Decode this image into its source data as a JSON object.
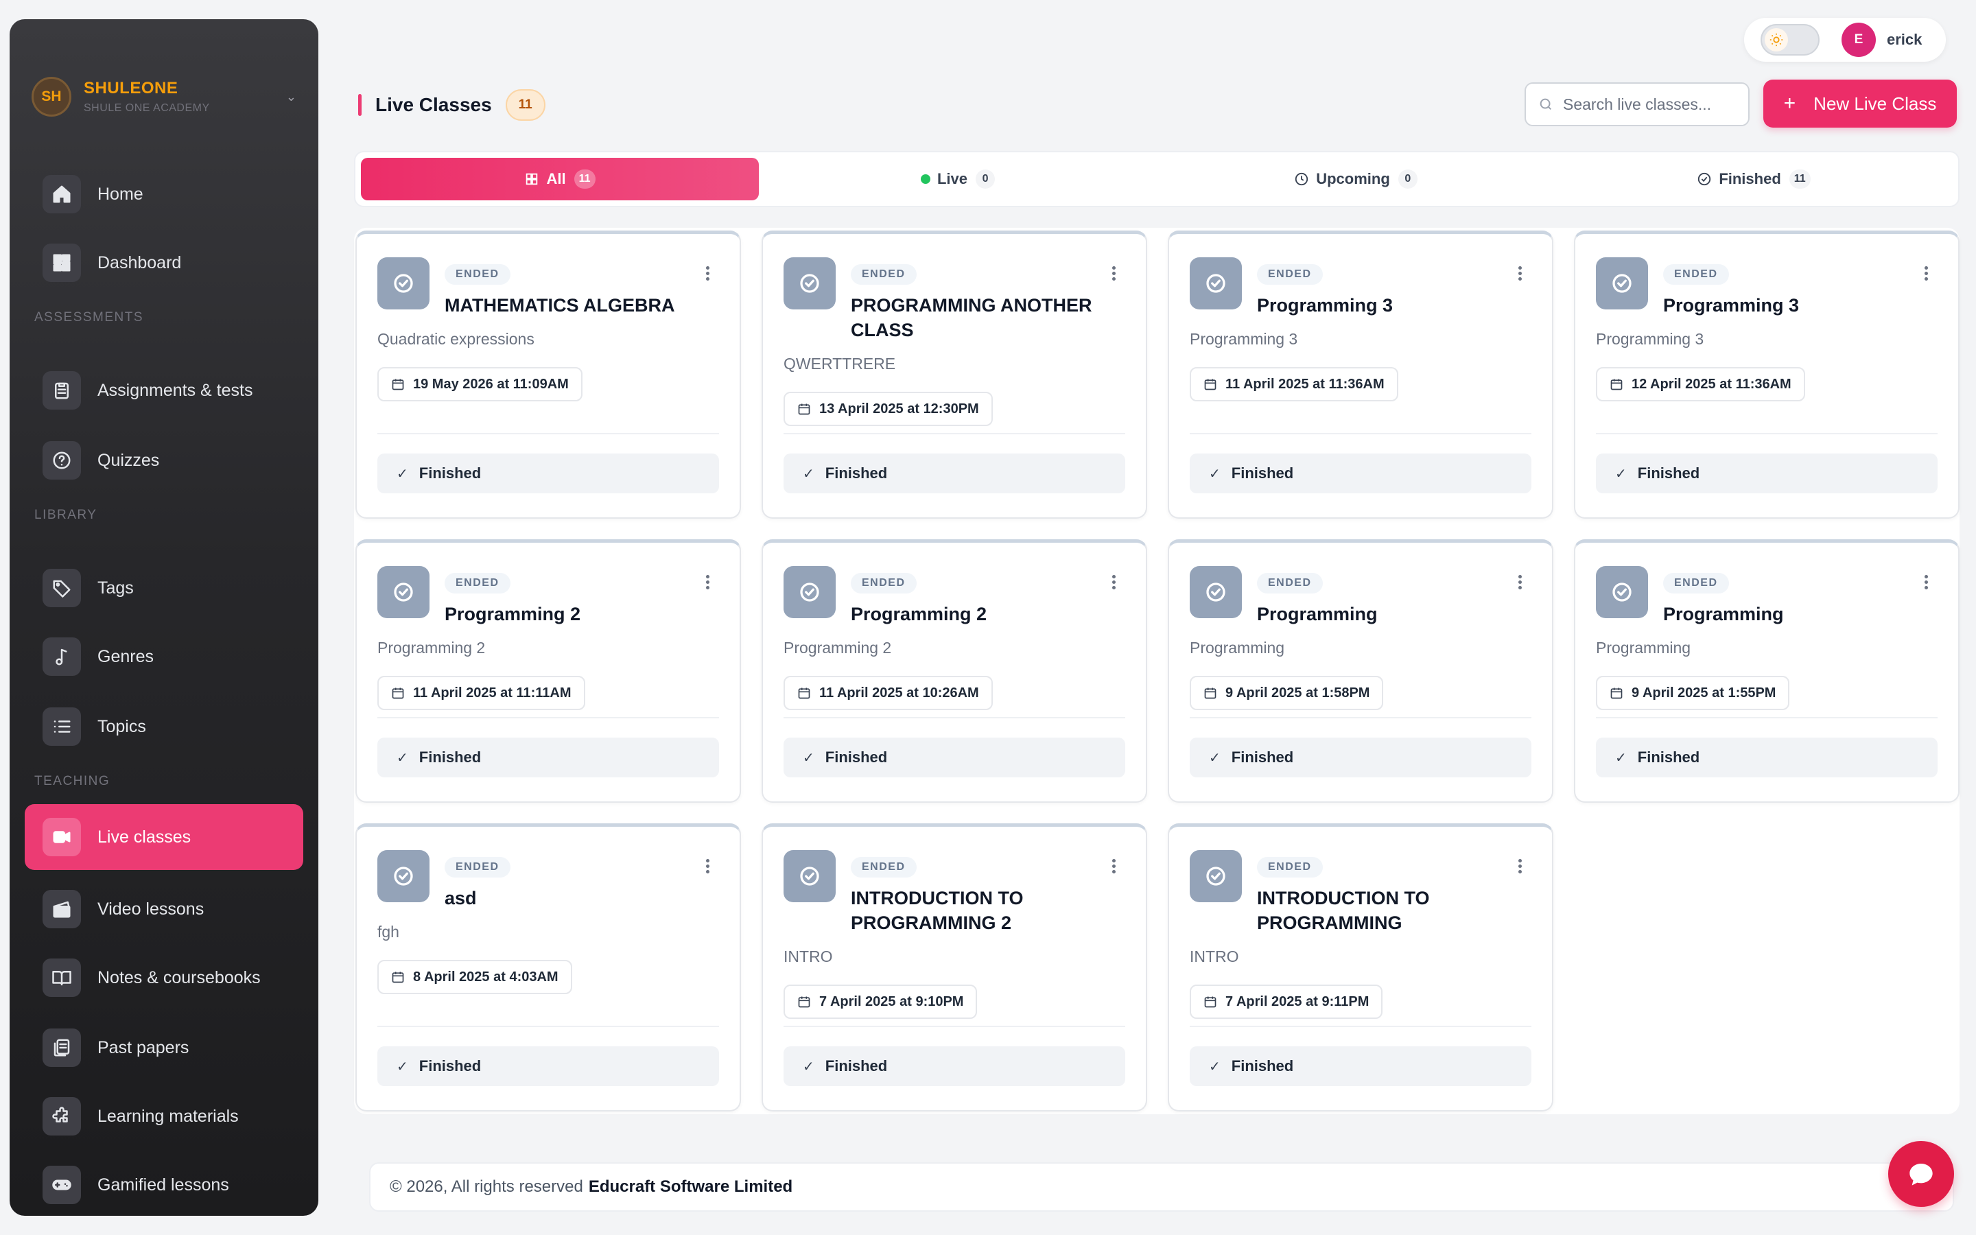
{
  "org": {
    "initials": "SH",
    "name": "SHULEONE",
    "subtitle": "SHULE ONE ACADEMY"
  },
  "sidebar": {
    "items": [
      {
        "label": "Home"
      },
      {
        "label": "Dashboard"
      },
      {
        "label": "Assignments & tests"
      },
      {
        "label": "Quizzes"
      },
      {
        "label": "Tags"
      },
      {
        "label": "Genres"
      },
      {
        "label": "Topics"
      },
      {
        "label": "Live classes"
      },
      {
        "label": "Video lessons"
      },
      {
        "label": "Notes & coursebooks"
      },
      {
        "label": "Past papers"
      },
      {
        "label": "Learning materials"
      },
      {
        "label": "Gamified lessons"
      }
    ],
    "sections": {
      "assessments": "ASSESSMENTS",
      "library": "LIBRARY",
      "teaching": "TEACHING"
    }
  },
  "user": {
    "initial": "E",
    "name": "erick"
  },
  "header": {
    "title": "Live Classes",
    "count": "11",
    "search_placeholder": "Search live classes...",
    "new_button": "New Live Class"
  },
  "tabs": [
    {
      "label": "All",
      "count": "11"
    },
    {
      "label": "Live",
      "count": "0"
    },
    {
      "label": "Upcoming",
      "count": "0"
    },
    {
      "label": "Finished",
      "count": "11"
    }
  ],
  "cards": [
    {
      "status": "ENDED",
      "title": "MATHEMATICS ALGEBRA",
      "subtitle": "Quadratic expressions",
      "date": "19 May 2026 at 11:09AM",
      "action": "Finished"
    },
    {
      "status": "ENDED",
      "title": "PROGRAMMING ANOTHER CLASS",
      "subtitle": "QWERTTRERE",
      "date": "13 April 2025 at 12:30PM",
      "action": "Finished"
    },
    {
      "status": "ENDED",
      "title": "Programming 3",
      "subtitle": "Programming 3",
      "date": "11 April 2025 at 11:36AM",
      "action": "Finished"
    },
    {
      "status": "ENDED",
      "title": "Programming 3",
      "subtitle": "Programming 3",
      "date": "12 April 2025 at 11:36AM",
      "action": "Finished"
    },
    {
      "status": "ENDED",
      "title": "Programming 2",
      "subtitle": "Programming 2",
      "date": "11 April 2025 at 11:11AM",
      "action": "Finished"
    },
    {
      "status": "ENDED",
      "title": "Programming 2",
      "subtitle": "Programming 2",
      "date": "11 April 2025 at 10:26AM",
      "action": "Finished"
    },
    {
      "status": "ENDED",
      "title": "Programming",
      "subtitle": "Programming",
      "date": "9 April 2025 at 1:58PM",
      "action": "Finished"
    },
    {
      "status": "ENDED",
      "title": "Programming",
      "subtitle": "Programming",
      "date": "9 April 2025 at 1:55PM",
      "action": "Finished"
    },
    {
      "status": "ENDED",
      "title": "asd",
      "subtitle": "fgh",
      "date": "8 April 2025 at 4:03AM",
      "action": "Finished"
    },
    {
      "status": "ENDED",
      "title": "INTRODUCTION TO PROGRAMMING 2",
      "subtitle": "INTRO",
      "date": "7 April 2025 at 9:10PM",
      "action": "Finished"
    },
    {
      "status": "ENDED",
      "title": "INTRODUCTION TO PROGRAMMING",
      "subtitle": "INTRO",
      "date": "7 April 2025 at 9:11PM",
      "action": "Finished"
    }
  ],
  "footer": {
    "copyright": "© 2026, All rights reserved",
    "company": "Educraft Software Limited"
  },
  "colors": {
    "accent": "#ec2d68",
    "org": "#f59e0b",
    "live": "#22c55e"
  }
}
